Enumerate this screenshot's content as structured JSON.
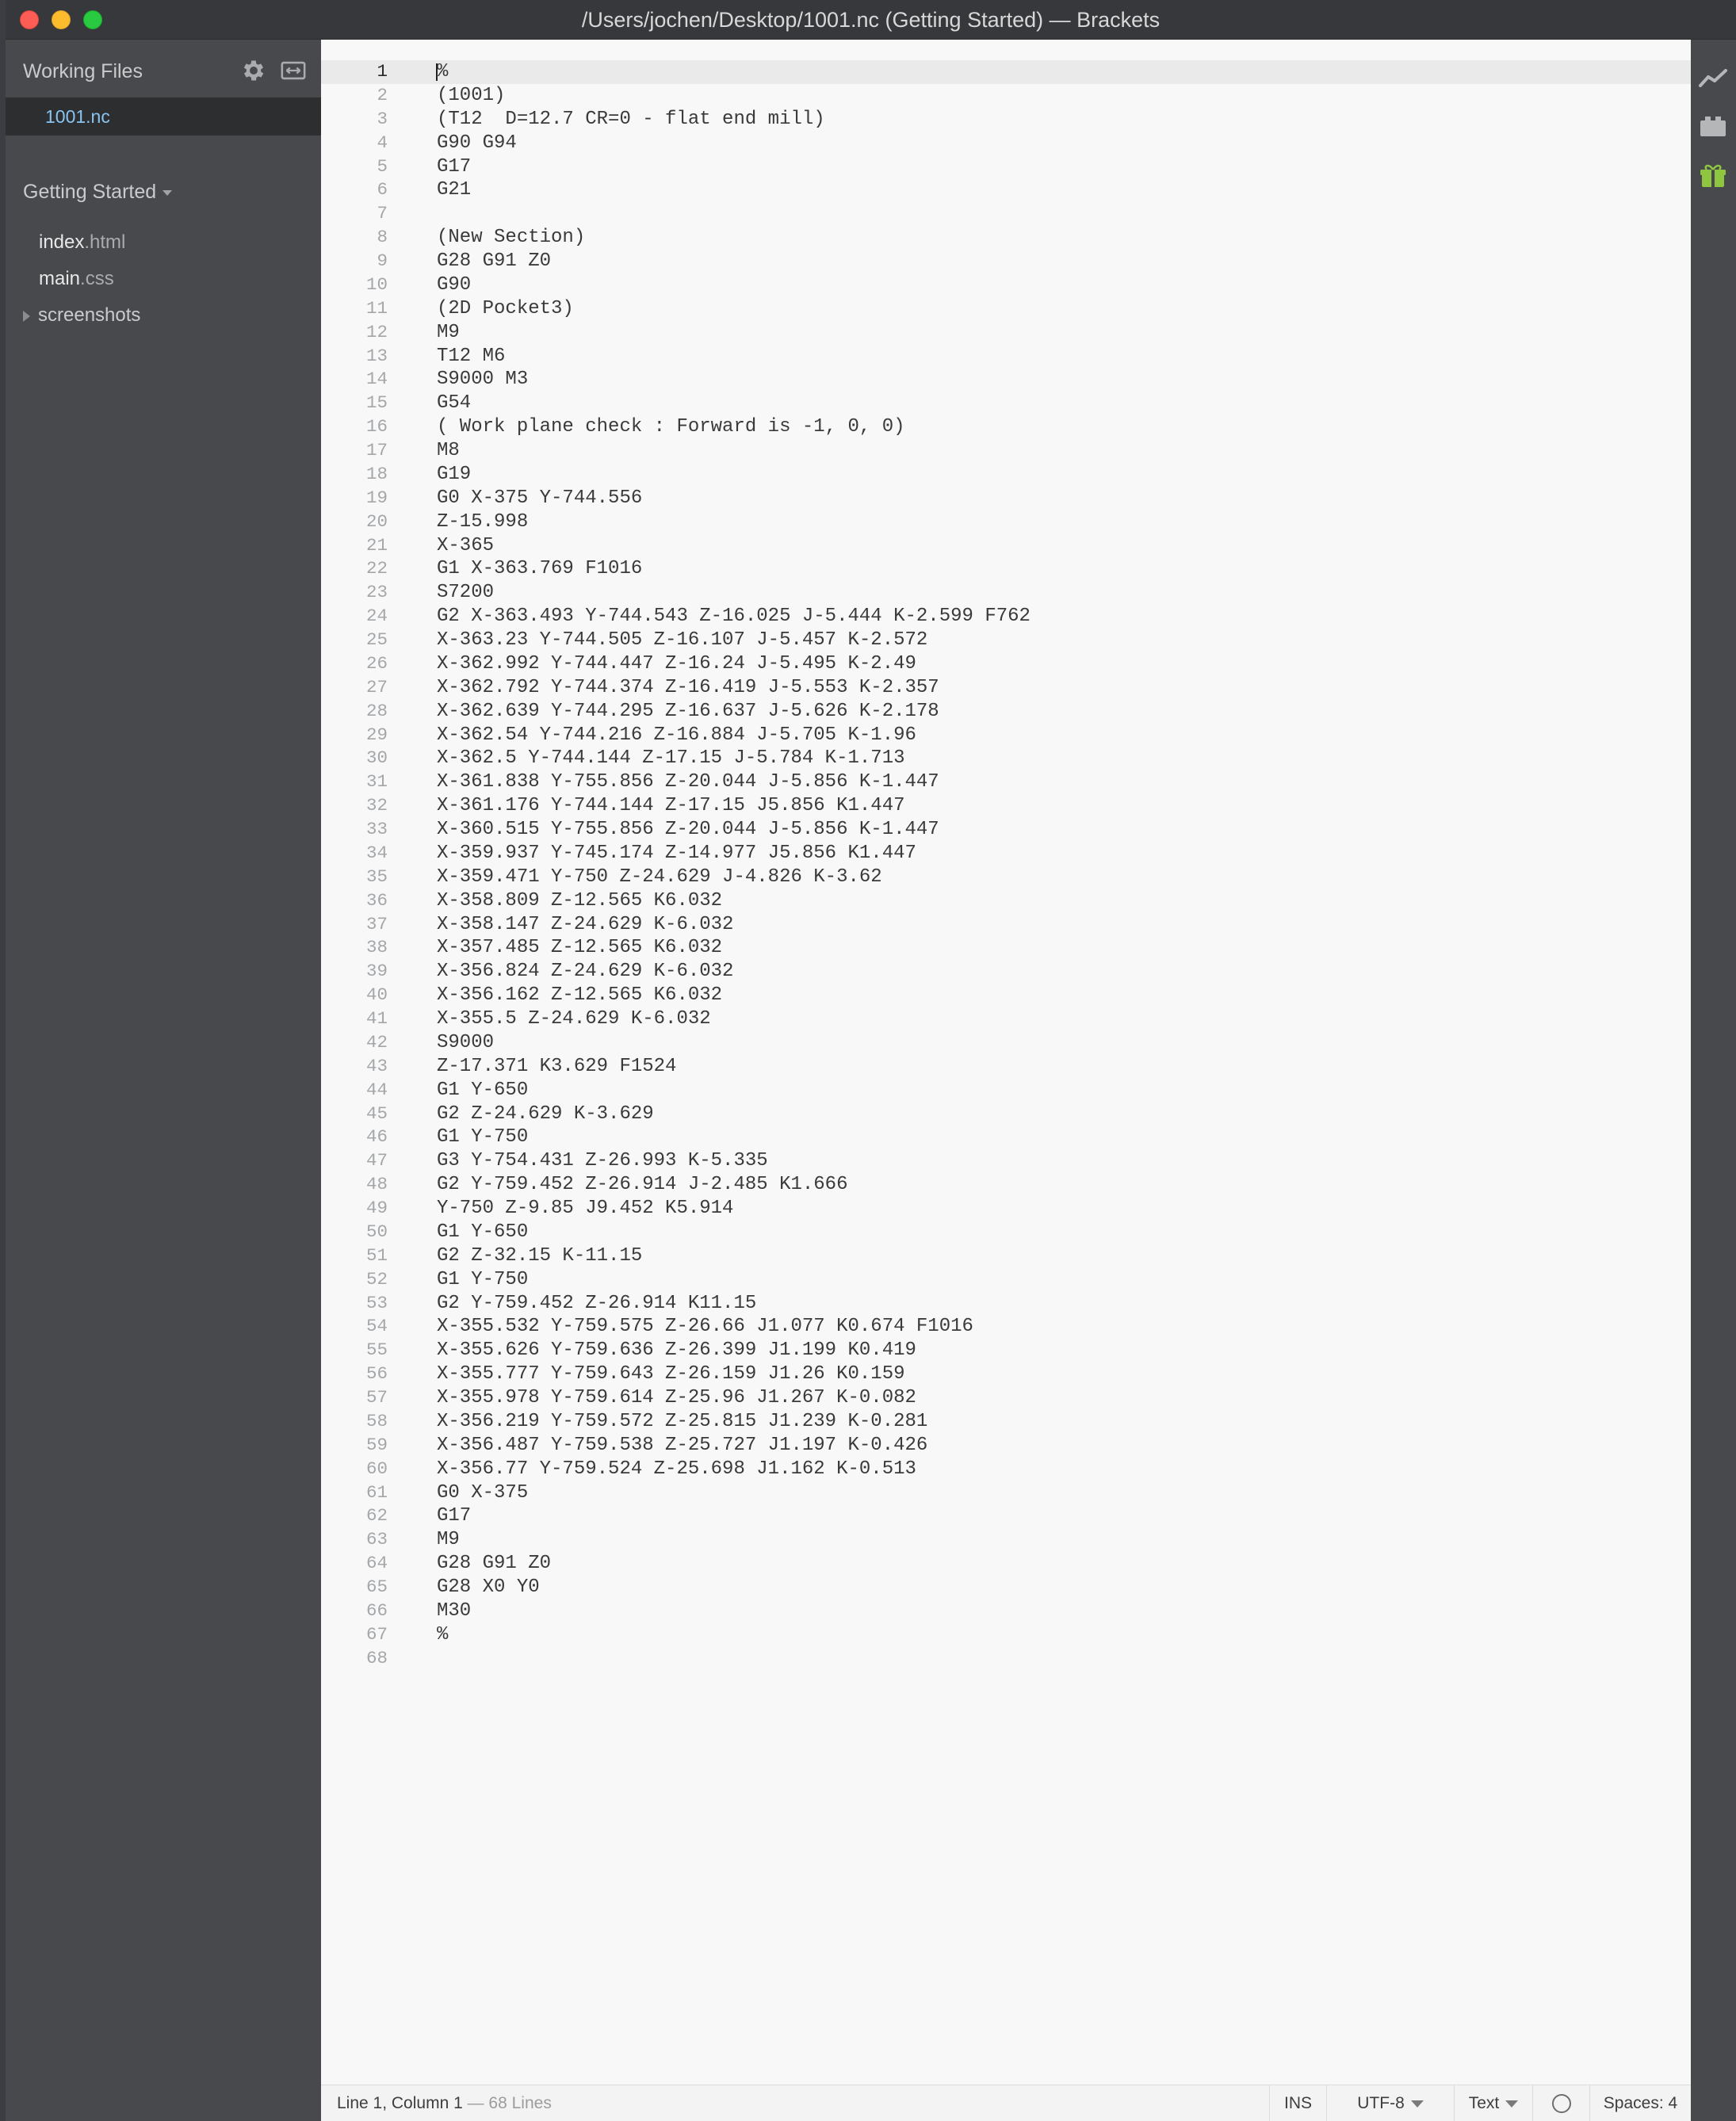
{
  "window": {
    "title": "/Users/jochen/Desktop/1001.nc (Getting Started) — Brackets"
  },
  "sidebar": {
    "working_files_label": "Working Files",
    "working_files": [
      {
        "name": "1001.nc"
      }
    ],
    "project_label": "Getting Started",
    "tree": [
      {
        "base": "index",
        "ext": ".html"
      },
      {
        "base": "main",
        "ext": ".css"
      }
    ],
    "folder": "screenshots"
  },
  "editor": {
    "lines": [
      "%",
      "(1001)",
      "(T12  D=12.7 CR=0 - flat end mill)",
      "G90 G94",
      "G17",
      "G21",
      "",
      "(New Section)",
      "G28 G91 Z0",
      "G90",
      "(2D Pocket3)",
      "M9",
      "T12 M6",
      "S9000 M3",
      "G54",
      "( Work plane check : Forward is -1, 0, 0)",
      "M8",
      "G19",
      "G0 X-375 Y-744.556",
      "Z-15.998",
      "X-365",
      "G1 X-363.769 F1016",
      "S7200",
      "G2 X-363.493 Y-744.543 Z-16.025 J-5.444 K-2.599 F762",
      "X-363.23 Y-744.505 Z-16.107 J-5.457 K-2.572",
      "X-362.992 Y-744.447 Z-16.24 J-5.495 K-2.49",
      "X-362.792 Y-744.374 Z-16.419 J-5.553 K-2.357",
      "X-362.639 Y-744.295 Z-16.637 J-5.626 K-2.178",
      "X-362.54 Y-744.216 Z-16.884 J-5.705 K-1.96",
      "X-362.5 Y-744.144 Z-17.15 J-5.784 K-1.713",
      "X-361.838 Y-755.856 Z-20.044 J-5.856 K-1.447",
      "X-361.176 Y-744.144 Z-17.15 J5.856 K1.447",
      "X-360.515 Y-755.856 Z-20.044 J-5.856 K-1.447",
      "X-359.937 Y-745.174 Z-14.977 J5.856 K1.447",
      "X-359.471 Y-750 Z-24.629 J-4.826 K-3.62",
      "X-358.809 Z-12.565 K6.032",
      "X-358.147 Z-24.629 K-6.032",
      "X-357.485 Z-12.565 K6.032",
      "X-356.824 Z-24.629 K-6.032",
      "X-356.162 Z-12.565 K6.032",
      "X-355.5 Z-24.629 K-6.032",
      "S9000",
      "Z-17.371 K3.629 F1524",
      "G1 Y-650",
      "G2 Z-24.629 K-3.629",
      "G1 Y-750",
      "G3 Y-754.431 Z-26.993 K-5.335",
      "G2 Y-759.452 Z-26.914 J-2.485 K1.666",
      "Y-750 Z-9.85 J9.452 K5.914",
      "G1 Y-650",
      "G2 Z-32.15 K-11.15",
      "G1 Y-750",
      "G2 Y-759.452 Z-26.914 K11.15",
      "X-355.532 Y-759.575 Z-26.66 J1.077 K0.674 F1016",
      "X-355.626 Y-759.636 Z-26.399 J1.199 K0.419",
      "X-355.777 Y-759.643 Z-26.159 J1.26 K0.159",
      "X-355.978 Y-759.614 Z-25.96 J1.267 K-0.082",
      "X-356.219 Y-759.572 Z-25.815 J1.239 K-0.281",
      "X-356.487 Y-759.538 Z-25.727 J1.197 K-0.426",
      "X-356.77 Y-759.524 Z-25.698 J1.162 K-0.513",
      "G0 X-375",
      "G17",
      "M9",
      "G28 G91 Z0",
      "G28 X0 Y0",
      "M30",
      "%",
      ""
    ]
  },
  "statusbar": {
    "position": "Line 1, Column 1",
    "line_count": " — 68 Lines",
    "mode": "INS",
    "encoding": "UTF-8",
    "language": "Text",
    "indent": "Spaces: 4"
  },
  "toolbar": {
    "icons": [
      "live-preview-icon",
      "extension-manager-icon",
      "gift-icon"
    ]
  },
  "colors": {
    "titlebar": "#36383b",
    "sidebar": "#47494c",
    "sidebar_selected": "#2d2e30",
    "selected_file": "#88c4f2",
    "editor_bg": "#f8f8f8",
    "gift_icon": "#8ec640"
  }
}
